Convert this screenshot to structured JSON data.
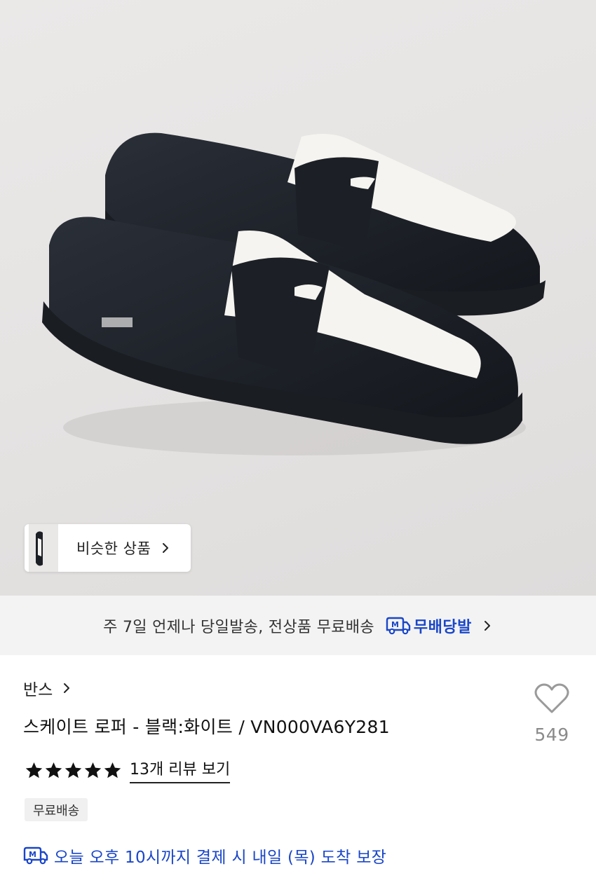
{
  "similar_products": {
    "label": "비슷한 상품"
  },
  "shipping_banner": {
    "text": "주 7일 언제나 당일발송, 전상품 무료배송",
    "brand_badge": "M",
    "brand": "무배당발"
  },
  "product": {
    "brand": "반스",
    "title": "스케이트 로퍼 - 블랙:화이트 / VN000VA6Y281",
    "likes": "549",
    "rating_stars": 5,
    "reviews_label": "13개 리뷰 보기",
    "free_shipping_badge": "무료배송",
    "delivery_badge": "M",
    "delivery_promise": "오늘 오후 10시까지 결제 시 내일 (목) 도착 보장"
  },
  "colors": {
    "accent_blue": "#1a46c8",
    "banner_bg": "#f3f3f3",
    "muted_text": "#8a8a8a"
  },
  "icons": [
    "chevron-right-icon",
    "truck-icon",
    "heart-icon",
    "star-icon"
  ]
}
